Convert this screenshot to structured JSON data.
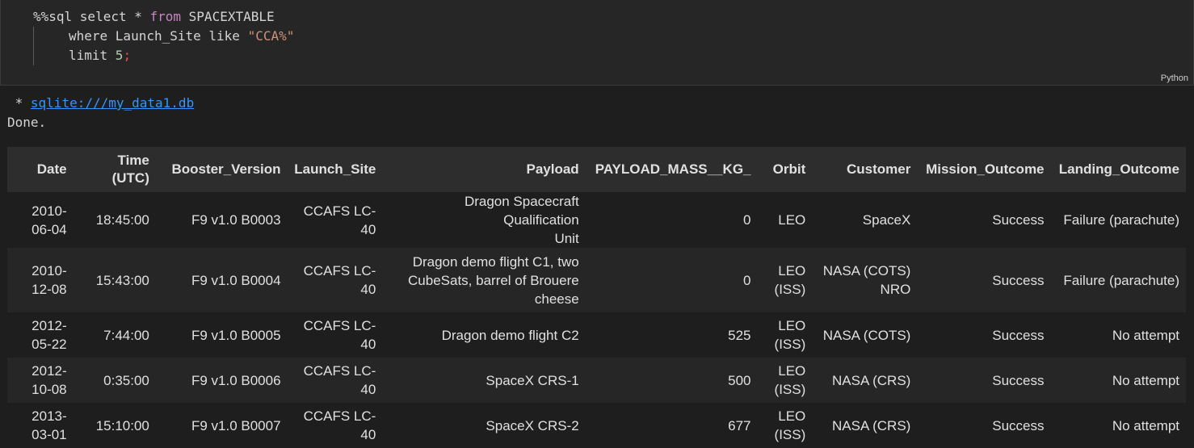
{
  "code_cell": {
    "line1_magic": "%%sql select * ",
    "line1_from": "from",
    "line1_table": " SPACEXTABLE",
    "line2_prefix": "where Launch_Site like ",
    "line2_string": "\"CCA%\"",
    "line3_prefix": "limit ",
    "line3_number": "5",
    "line3_semicolon": ";",
    "language": "Python"
  },
  "output": {
    "connection_prefix": " * ",
    "connection_link": "sqlite:///my_data1.db",
    "status": "Done."
  },
  "table": {
    "headers": {
      "date": "Date",
      "time_line1": "Time",
      "time_line2": "(UTC)",
      "booster": "Booster_Version",
      "site": "Launch_Site",
      "payload": "Payload",
      "mass": "PAYLOAD_MASS__KG_",
      "orbit": "Orbit",
      "customer": "Customer",
      "mission": "Mission_Outcome",
      "landing": "Landing_Outcome"
    },
    "rows": [
      {
        "date_a": "2010-",
        "date_b": "06-04",
        "time": "18:45:00",
        "booster": "F9 v1.0 B0003",
        "site_a": "CCAFS LC-",
        "site_b": "40",
        "payload_a": "Dragon Spacecraft Qualification",
        "payload_b": "Unit",
        "payload_c": "",
        "mass": "0",
        "orbit_a": "LEO",
        "orbit_b": "",
        "customer_a": "SpaceX",
        "customer_b": "",
        "mission": "Success",
        "landing": "Failure (parachute)"
      },
      {
        "date_a": "2010-",
        "date_b": "12-08",
        "time": "15:43:00",
        "booster": "F9 v1.0 B0004",
        "site_a": "CCAFS LC-",
        "site_b": "40",
        "payload_a": "Dragon demo flight C1, two",
        "payload_b": "CubeSats, barrel of Brouere",
        "payload_c": "cheese",
        "mass": "0",
        "orbit_a": "LEO",
        "orbit_b": "(ISS)",
        "customer_a": "NASA (COTS)",
        "customer_b": "NRO",
        "mission": "Success",
        "landing": "Failure (parachute)"
      },
      {
        "date_a": "2012-",
        "date_b": "05-22",
        "time": "7:44:00",
        "booster": "F9 v1.0 B0005",
        "site_a": "CCAFS LC-",
        "site_b": "40",
        "payload_a": "Dragon demo flight C2",
        "payload_b": "",
        "payload_c": "",
        "mass": "525",
        "orbit_a": "LEO",
        "orbit_b": "(ISS)",
        "customer_a": "NASA (COTS)",
        "customer_b": "",
        "mission": "Success",
        "landing": "No attempt"
      },
      {
        "date_a": "2012-",
        "date_b": "10-08",
        "time": "0:35:00",
        "booster": "F9 v1.0 B0006",
        "site_a": "CCAFS LC-",
        "site_b": "40",
        "payload_a": "SpaceX CRS-1",
        "payload_b": "",
        "payload_c": "",
        "mass": "500",
        "orbit_a": "LEO",
        "orbit_b": "(ISS)",
        "customer_a": "NASA (CRS)",
        "customer_b": "",
        "mission": "Success",
        "landing": "No attempt"
      },
      {
        "date_a": "2013-",
        "date_b": "03-01",
        "time": "15:10:00",
        "booster": "F9 v1.0 B0007",
        "site_a": "CCAFS LC-",
        "site_b": "40",
        "payload_a": "SpaceX CRS-2",
        "payload_b": "",
        "payload_c": "",
        "mass": "677",
        "orbit_a": "LEO",
        "orbit_b": "(ISS)",
        "customer_a": "NASA (CRS)",
        "customer_b": "",
        "mission": "Success",
        "landing": "No attempt"
      }
    ]
  }
}
